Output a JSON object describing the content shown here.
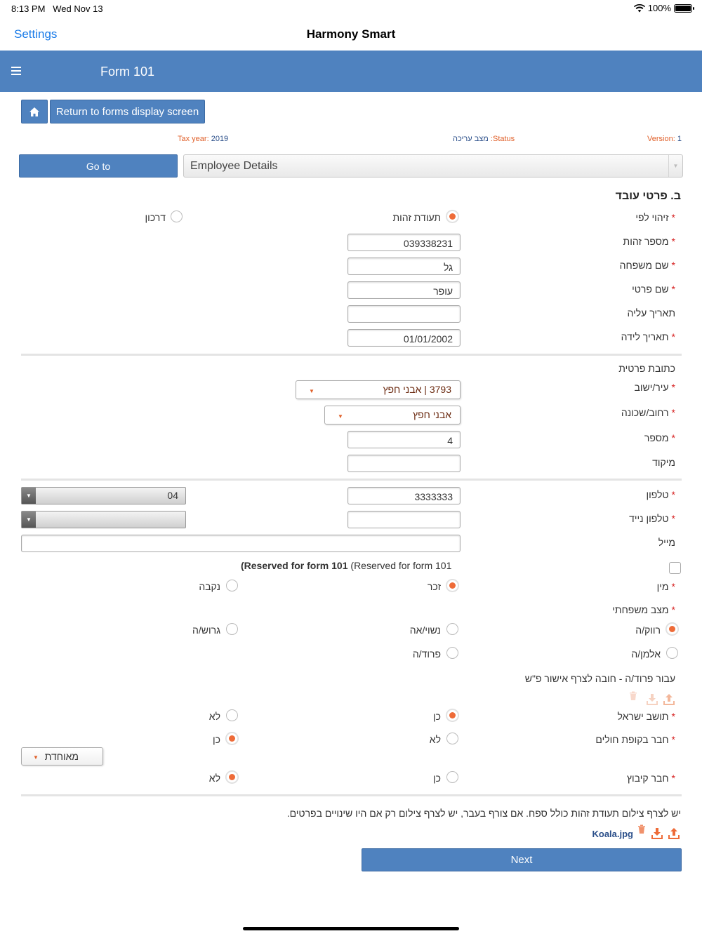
{
  "status_bar": {
    "time": "8:13 PM",
    "date": "Wed Nov 13",
    "battery": "100%",
    "icons": [
      "wifi-icon",
      "battery-icon"
    ]
  },
  "nav": {
    "back_label": "Settings",
    "title": "Harmony Smart"
  },
  "header": {
    "menu_icon": "hamburger-icon",
    "title": "Form 101"
  },
  "toolbar": {
    "home_icon": "home-icon",
    "return_label": "Return to forms display screen"
  },
  "meta": {
    "tax_year_label": "Tax year:",
    "tax_year_value": "2019",
    "status_label": ":Status",
    "status_value": "מצב עריכה",
    "version_label": "Version:",
    "version_value": "1"
  },
  "goto": {
    "button_label": "Go to",
    "selected_section": "Employee Details"
  },
  "section_title": "ב. פרטי עובד",
  "fields": {
    "id_by": {
      "label": "זיהוי לפי",
      "option_id": "תעודת זהות",
      "option_passport": "דרכון"
    },
    "id_number": {
      "label": "מספר זהות",
      "value": "039338231"
    },
    "last_name": {
      "label": "שם משפחה",
      "value": "גל"
    },
    "first_name": {
      "label": "שם פרטי",
      "value": "עופר"
    },
    "aliyah_date": {
      "label": "תאריך עליה",
      "value": ""
    },
    "birth_date": {
      "label": "תאריך לידה",
      "value": "01/01/2002"
    }
  },
  "address": {
    "title": "כתובת פרטית",
    "city": {
      "label": "עיר/ישוב",
      "value": "3793 | אבני חפץ"
    },
    "street": {
      "label": "רחוב/שכונה",
      "value": "אבני חפץ"
    },
    "number": {
      "label": "מספר",
      "value": "4"
    },
    "zip": {
      "label": "מיקוד",
      "value": ""
    }
  },
  "contact": {
    "phone": {
      "label": "טלפון",
      "value": "3333333",
      "prefix": "04"
    },
    "mobile": {
      "label": "טלפון נייד",
      "value": "",
      "prefix": ""
    },
    "email": {
      "label": "מייל",
      "value": ""
    }
  },
  "reserved": {
    "bold": "(Reserved for form 101",
    "normal": "(Reserved for form 101"
  },
  "gender": {
    "label": "מין",
    "male": "זכר",
    "female": "נקבה"
  },
  "marital": {
    "label": "מצב משפחתי",
    "single": "רווק/ה",
    "married": "נשוי/אה",
    "divorced": "גרוש/ה",
    "widowed": "אלמן/ה",
    "separated": "פרוד/ה"
  },
  "separated_note": "עבור פרוד/ה - חובה לצרף אישור פ\"ש",
  "resident": {
    "label": "תושב ישראל",
    "yes": "כן",
    "no": "לא"
  },
  "hmo": {
    "label": "חבר בקופת חולים",
    "yes": "כן",
    "no": "לא",
    "selected_fund": "מאוחדת"
  },
  "kibbutz": {
    "label": "חבר קיבוץ",
    "yes": "כן",
    "no": "לא"
  },
  "id_copy_note": "יש לצרף צילום תעודת זהות כולל ספח. אם צורף בעבר, יש לצרף צילום רק אם היו שינויים בפרטים.",
  "attachment": {
    "file_name": "Koala.jpg"
  },
  "next_label": "Next",
  "colors": {
    "brand_blue": "#4f82bf",
    "accent_orange": "#ee6b38",
    "required_red": "#d62020"
  }
}
